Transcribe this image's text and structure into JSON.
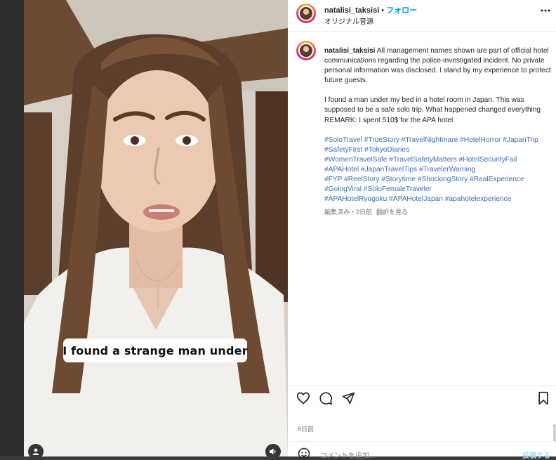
{
  "header": {
    "username": "natalisi_taksisi",
    "separator": "•",
    "follow_label": "フォロー",
    "audio_label": "オリジナル音源",
    "more_icon": "more-horizontal-icon"
  },
  "video": {
    "subtitle": "I found a strange man under",
    "user_icon": "user-tag-icon",
    "mute_icon": "speaker-icon"
  },
  "caption": {
    "username": "natalisi_taksisi",
    "paragraph1": "All management names shown are part of official hotel communications regarding the police-investigated incident. No private personal information was disclosed. I stand by my experience to protect future guests.",
    "paragraph2": "I found a man under my bed in a hotel room in Japan. This was supposed to be a safe solo trip. What happened changed everything",
    "paragraph3": "REMARK: I spent 510$ for the APA hotel",
    "hashtag_lines": [
      "#SoloTravel #TrueStory #TravelNightmare #HotelHorror #JapanTrip",
      "#SafetyFirst #TokyoDiaries",
      "#WomenTravelSafe #TravelSafetyMatters #HotelSecurityFail",
      "#APAHotel #JapanTravelTips #TravelerWarning",
      "#FYP #ReelStory #Storytime #ShockingStory #RealExperience",
      "#GoingViral #SoloFemaleTraveler",
      "#APAHotelRyogoku #APAHotelJapan #apahotelexperience"
    ],
    "meta_edited": "編集済み・2日前",
    "meta_translate": "翻訳を見る"
  },
  "actions": {
    "like_icon": "heart-icon",
    "comment_icon": "comment-icon",
    "share_icon": "send-icon",
    "save_icon": "bookmark-icon"
  },
  "post_date": "6日前",
  "comment": {
    "emoji_icon": "emoji-icon",
    "placeholder": "コメントを追加...",
    "post_label": "投稿する"
  },
  "colors": {
    "link_blue": "#0095f6",
    "hashtag_blue": "#3f6fb5"
  }
}
